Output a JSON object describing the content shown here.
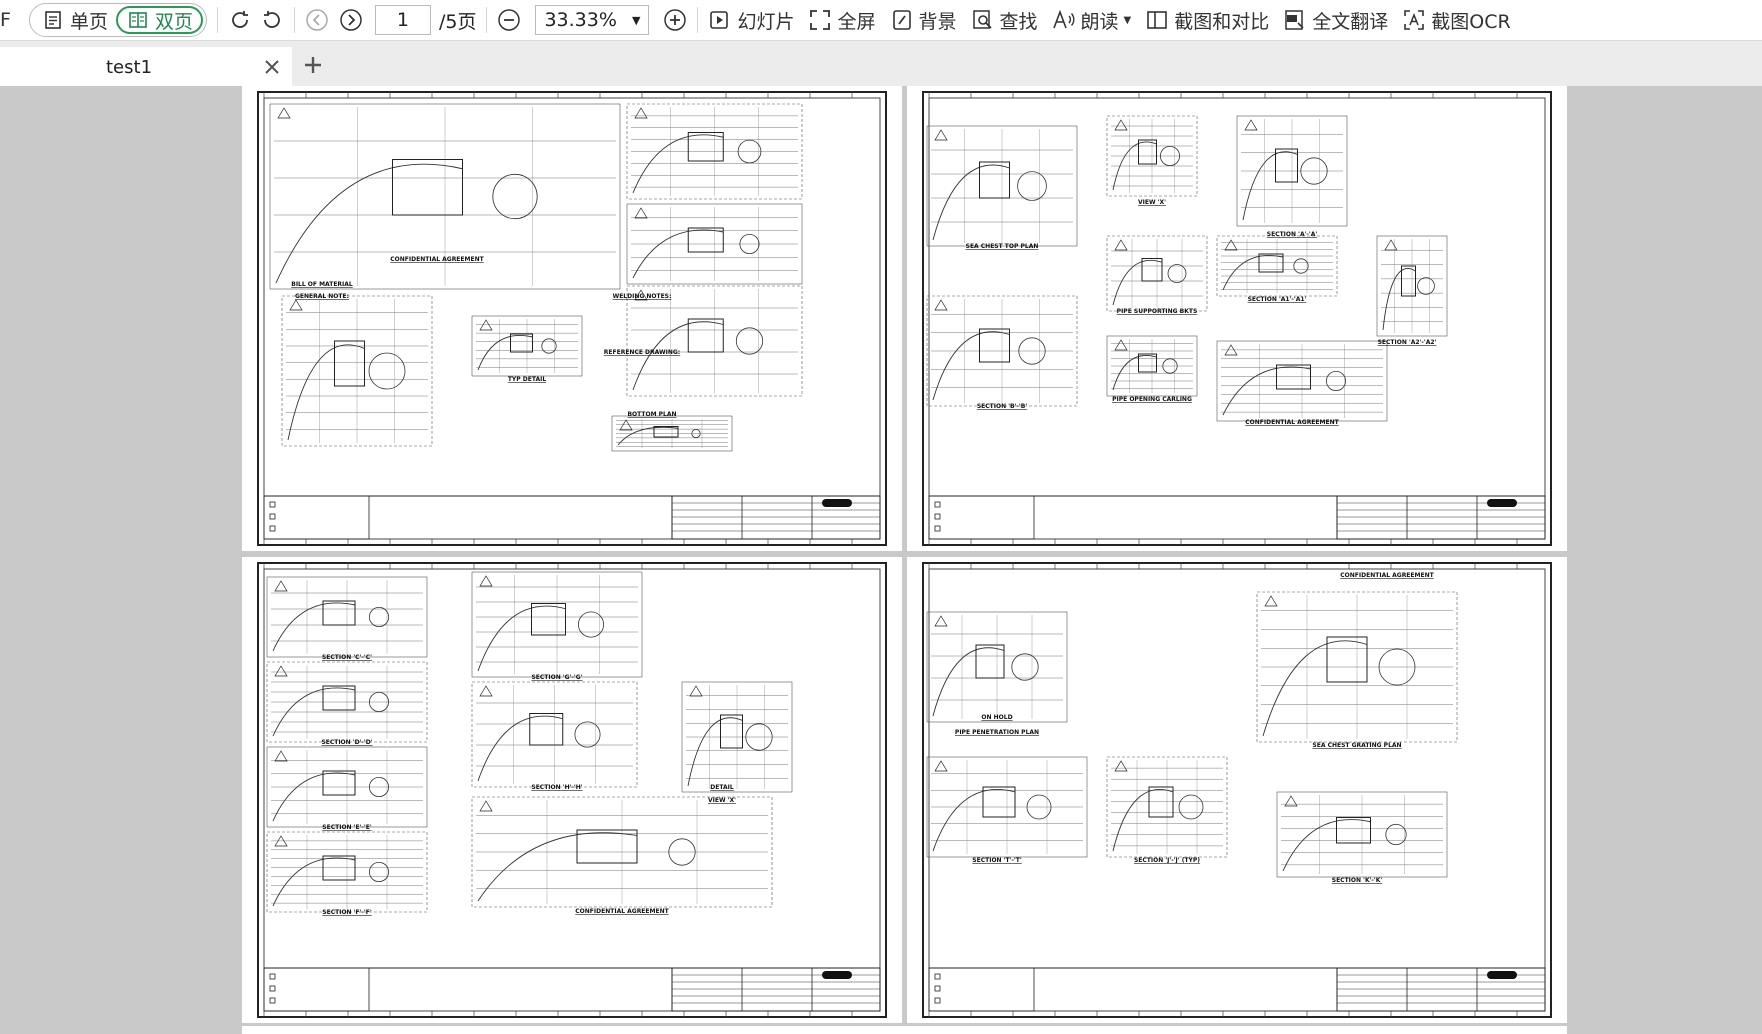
{
  "app": {
    "left_fragment": "F"
  },
  "toolbar": {
    "single_page": "单页",
    "double_page": "双页",
    "page_current": "1",
    "page_total": "/5页",
    "zoom": "33.33%",
    "slideshow": "幻灯片",
    "fullscreen": "全屏",
    "background": "背景",
    "find": "查找",
    "read_aloud": "朗读",
    "screenshot_compare": "截图和对比",
    "translate": "全文翻译",
    "ocr": "截图OCR"
  },
  "tabs": [
    {
      "label": "test1"
    }
  ],
  "pages": [
    {
      "labels": [
        "BILL OF MATERIAL",
        "GENERAL NOTE:",
        "WELDING NOTES:",
        "REFERENCE DRAWING:",
        "BOTTOM PLAN",
        "TYP DETAIL",
        "CONFIDENTIAL AGREEMENT"
      ]
    },
    {
      "labels": [
        "SEA CHEST TOP PLAN",
        "VIEW 'X'",
        "SECTION 'A'-'A'",
        "SECTION 'A1'-'A1'",
        "SECTION 'A2'-'A2'",
        "PIPE SUPPORTING BKTS",
        "PIPE OPENING CARLING",
        "SECTION 'B'-'B'",
        "CONFIDENTIAL AGREEMENT"
      ]
    },
    {
      "labels": [
        "SECTION 'C'-'C'",
        "SECTION 'D'-'D'",
        "SECTION 'E'-'E'",
        "SECTION 'F'-'F'",
        "SECTION 'G'-'G'",
        "SECTION 'H'-'H'",
        "DETAIL",
        "VIEW 'X'",
        "CONFIDENTIAL AGREEMENT"
      ]
    },
    {
      "labels": [
        "ON HOLD",
        "PIPE PENETRATION PLAN",
        "SEA CHEST GRATING PLAN",
        "SECTION 'T'-'T'",
        "SECTION 'J'-'J' (TYP)",
        "SECTION 'K'-'K'",
        "CONFIDENTIAL AGREEMENT"
      ]
    }
  ]
}
